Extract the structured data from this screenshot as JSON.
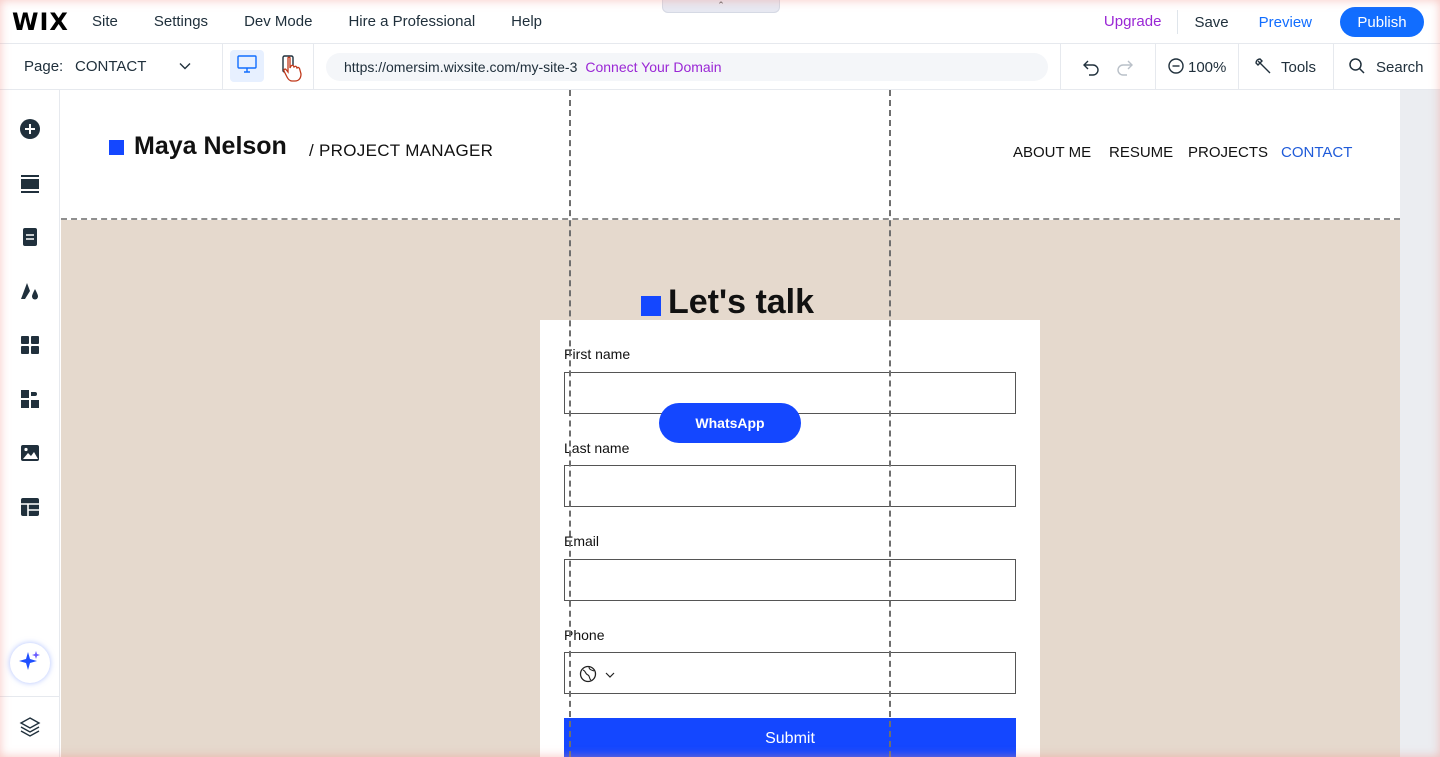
{
  "topbar": {
    "logo": "WIX",
    "menu": [
      "Site",
      "Settings",
      "Dev Mode",
      "Hire a Professional",
      "Help"
    ],
    "upgrade": "Upgrade",
    "save": "Save",
    "preview": "Preview",
    "publish": "Publish",
    "collapse_glyph": "⌃"
  },
  "toolbar": {
    "page_label": "Page:",
    "page_value": "CONTACT",
    "url": "https://omersim.wixsite.com/my-site-3",
    "connect_domain": "Connect Your Domain",
    "zoom": "100%",
    "tools": "Tools",
    "search": "Search"
  },
  "sidebar": {
    "items": [
      "add-elements-icon",
      "sections-icon",
      "pages-icon",
      "site-design-icon",
      "apps-icon",
      "business-apps-icon",
      "media-icon",
      "cms-icon",
      "ai-assistant-icon",
      "layers-icon"
    ]
  },
  "site": {
    "brand_name": "Maya Nelson",
    "brand_role": "/  PROJECT MANAGER",
    "nav": [
      "ABOUT ME",
      "RESUME",
      "PROJECTS",
      "CONTACT"
    ],
    "active_nav": "CONTACT",
    "section_title": "Let's talk",
    "form": {
      "first_name": "First name",
      "last_name": "Last name",
      "email": "Email",
      "phone": "Phone",
      "submit": "Submit"
    },
    "whatsapp": "WhatsApp"
  },
  "colors": {
    "accent": "#116dff",
    "site_blue": "#1447ff",
    "upgrade_purple": "#9a27d5",
    "section_bg": "#e5d9cd"
  }
}
